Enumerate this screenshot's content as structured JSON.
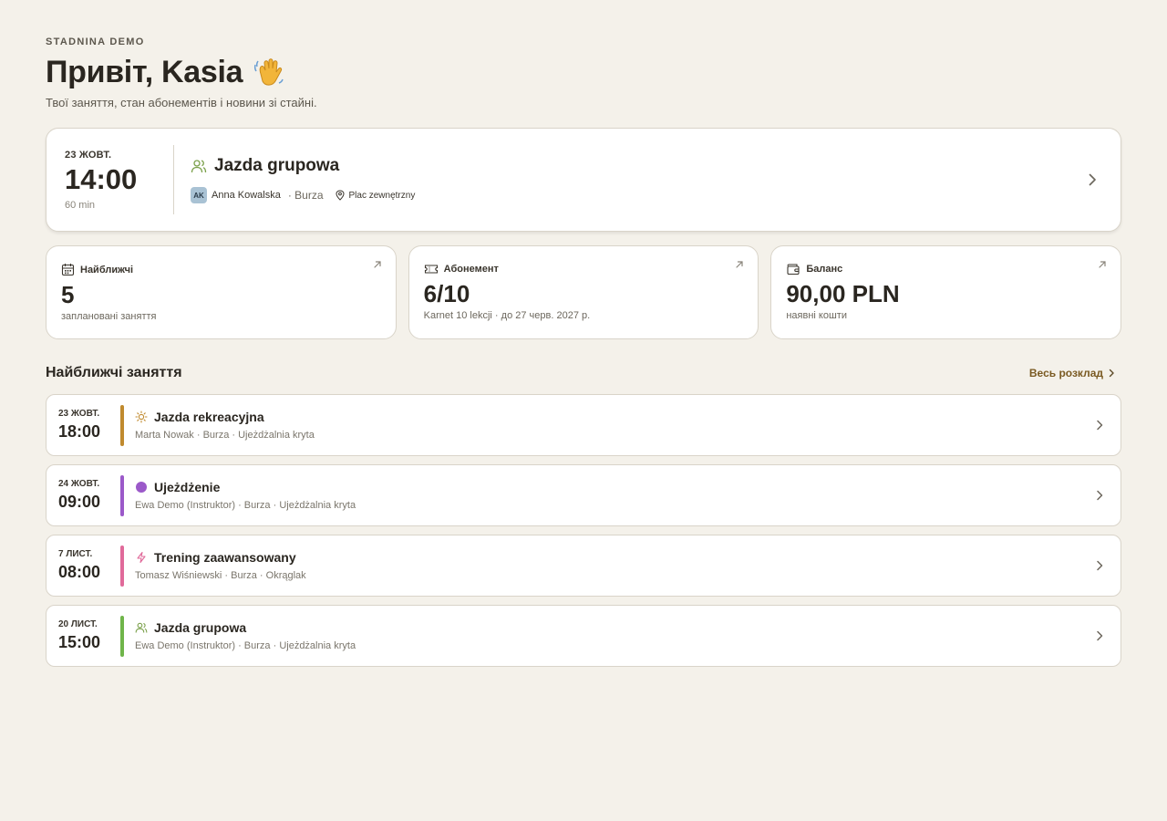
{
  "header": {
    "brand": "STADNINA DEMO",
    "greeting": "Привіт, Kasia",
    "subtitle": "Твої заняття, стан абонементів і новини зі стайні."
  },
  "next_lesson": {
    "date": "23 ЖОВТ.",
    "time": "14:00",
    "duration": "60 min",
    "title": "Jazda grupowa",
    "icon": "group-icon",
    "instructor_initials": "AK",
    "instructor": "Anna Kowalska",
    "horse": "· Burza",
    "place": "Plac zewnętrzny"
  },
  "stats": [
    {
      "label": "Найближчі",
      "icon": "calendar-icon",
      "value": "5",
      "sub": "заплановані заняття"
    },
    {
      "label": "Абонемент",
      "icon": "ticket-icon",
      "value": "6/10",
      "sub": "Karnet 10 lekcji · до 27 черв. 2027 р."
    },
    {
      "label": "Баланс",
      "icon": "wallet-icon",
      "value": "90,00 PLN",
      "sub": "наявні кошти"
    }
  ],
  "upcoming": {
    "title": "Найближчі заняття",
    "link": "Весь розклад",
    "items": [
      {
        "date": "23 ЖОВТ.",
        "time": "18:00",
        "title": "Jazda rekreacyjna",
        "sub": "Marta Nowak · Burza · Ujeżdżalnia kryta",
        "color": "#c08a2e",
        "icon": "sun-icon"
      },
      {
        "date": "24 ЖОВТ.",
        "time": "09:00",
        "title": "Ujeżdżenie",
        "sub": "Ewa Demo (Instruktor) · Burza · Ujeżdżalnia kryta",
        "color": "#9b59c9",
        "icon": "dot-icon"
      },
      {
        "date": "7 ЛИСТ.",
        "time": "08:00",
        "title": "Trening zaawansowany",
        "sub": "Tomasz Wiśniewski · Burza · Okrąglak",
        "color": "#e06a9a",
        "icon": "bolt-icon"
      },
      {
        "date": "20 ЛИСТ.",
        "time": "15:00",
        "title": "Jazda grupowa",
        "sub": "Ewa Demo (Instruktor) · Burza · Ujeżdżalnia kryta",
        "color": "#6fb54a",
        "icon": "group-icon"
      }
    ]
  }
}
